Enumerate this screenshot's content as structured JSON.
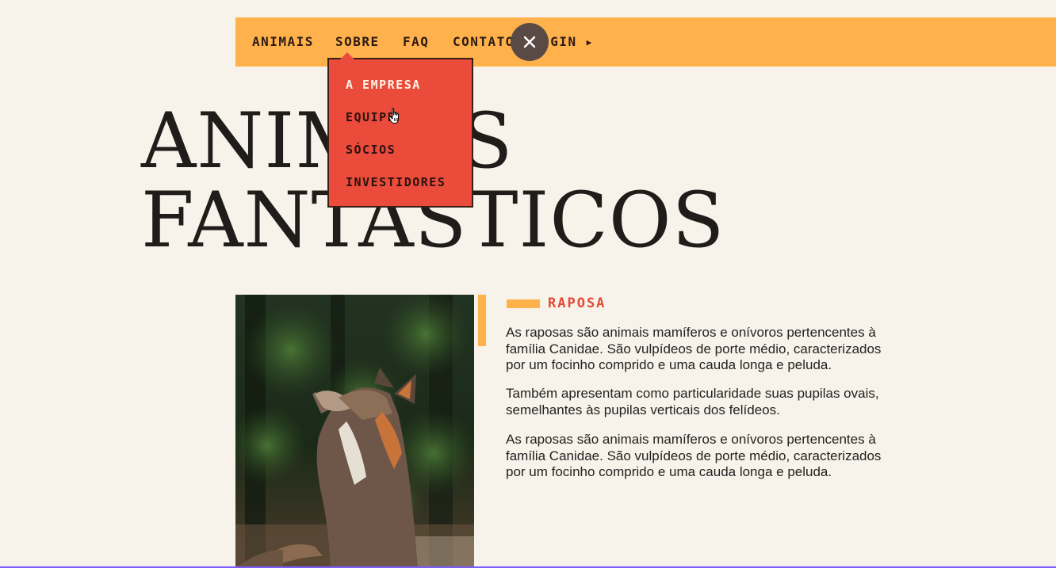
{
  "nav": {
    "items": [
      {
        "label": "ANIMAIS"
      },
      {
        "label": "SOBRE"
      },
      {
        "label": "FAQ"
      },
      {
        "label": "CONTATO"
      },
      {
        "label": "LOGIN"
      }
    ],
    "login_icon": "play-icon"
  },
  "close_button": {
    "icon": "close-icon"
  },
  "dropdown": {
    "items": [
      {
        "label": "A EMPRESA"
      },
      {
        "label": "EQUIPE"
      },
      {
        "label": "SÓCIOS"
      },
      {
        "label": "INVESTIDORES"
      }
    ]
  },
  "hero": {
    "line1": "ANIMAIS",
    "line2": "FANTASTICOS"
  },
  "article": {
    "title": "RAPOSA",
    "paragraphs": [
      "As raposas são animais mamíferos e onívoros pertencentes à família Canidae. São vulpídeos de porte médio, caracterizados por um focinho comprido e uma cauda longa e peluda.",
      "Também apresentam como particularidade suas pupilas ovais, semelhantes às pupilas verticais dos felídeos.",
      "As raposas são animais mamíferos e onívoros pertencentes à família Canidae. São vulpídeos de porte médio, caracterizados por um focinho comprido e uma cauda longa e peluda."
    ]
  },
  "colors": {
    "background": "#f8f3ea",
    "nav": "#ffb14b",
    "dropdown": "#ea4b3a",
    "accent_text": "#e24a36",
    "close_button": "#5a4a45"
  }
}
